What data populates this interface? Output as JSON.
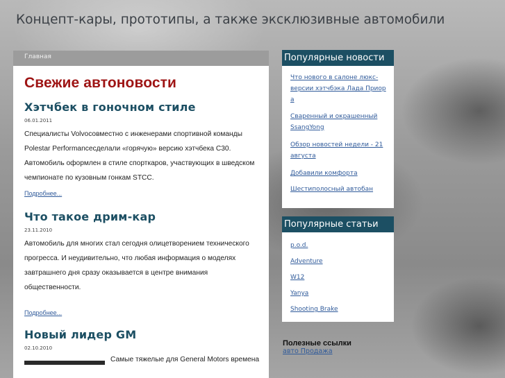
{
  "site": {
    "title": "Концепт-кары, прототипы, а также эксклюзивные автомобили"
  },
  "breadcrumb": {
    "home": "Главная"
  },
  "main": {
    "section_title": "Свежие автоновости",
    "articles": [
      {
        "title": "Хэтчбек в гоночном стиле",
        "date": "06.01.2011",
        "lines": [
          "Специалисты  Volvoсовместно с инженерами спортивной команды",
          "Polestar  Performanceсделали  «горячую» версию хэтчбека C30.",
          "Автомобиль оформлен в стиле спорткаров, участвующих в шведском",
          "чемпионате по кузовным гонкам STCC."
        ],
        "more": "Подробнее..."
      },
      {
        "title": "Что такое дрим-кар",
        "date": "23.11.2010",
        "lines": [
          "Автомобиль для многих стал сегодня олицетворением технического",
          "прогресса. И неудивительно, что любая информация о моделях",
          "завтрашнего дня сразу оказывается  в  центре    внимания",
          "общественности."
        ],
        "more": "Подробнее..."
      },
      {
        "title": "Новый лидер GM",
        "date": "02.10.2010",
        "lines": [
          "Самые тяжелые для General Motors времена"
        ]
      }
    ]
  },
  "popular_news": {
    "title": "Популярные новости",
    "items": [
      [
        "Что нового в салоне люкс-",
        "версии хэтчбэка Лада Приор",
        "а"
      ],
      [
        "Сваренный и окрашенный",
        "SsangYong"
      ],
      [
        "Обзор новостей недели - 21",
        "августа"
      ],
      [
        "Добавили комфорта"
      ],
      [
        "Шестиполосный автобан"
      ]
    ]
  },
  "popular_articles": {
    "title": "Популярные статьи",
    "items": [
      "p.o.d.",
      "Adventure",
      "W12",
      "Yanya",
      "Shooting Brake"
    ]
  },
  "useful_links": {
    "title": "Полезные ссылки",
    "items": [
      "авто Продажа"
    ]
  }
}
